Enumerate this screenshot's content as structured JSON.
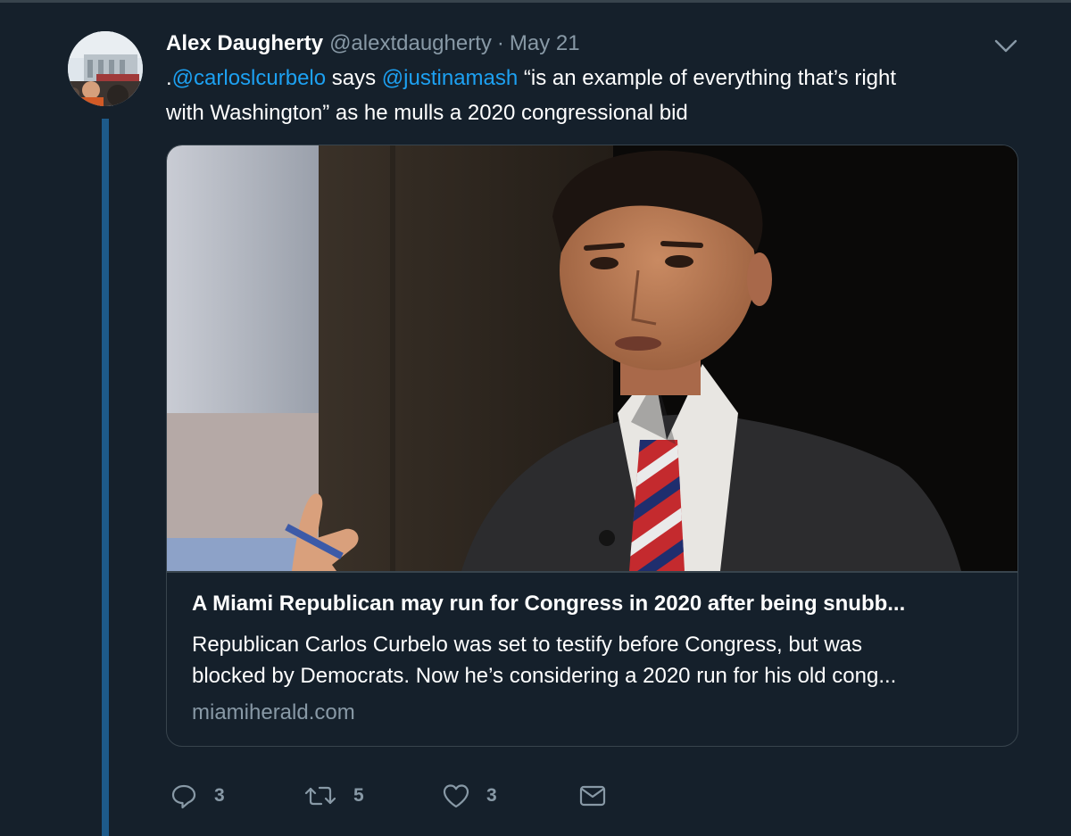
{
  "tweet": {
    "display_name": "Alex Daugherty",
    "handle": "@alextdaugherty",
    "separator": "·",
    "date": "May 21",
    "text": {
      "prefix": ".",
      "mention_1": "@carloslcurbelo",
      "middle": " says ",
      "mention_2": "@justinamash",
      "line1_rest": " “is an example of everything that’s right",
      "line2": "with Washington” as he mulls a 2020 congressional bid"
    }
  },
  "card": {
    "title": "A Miami Republican may run for Congress in 2020 after being snubb...",
    "description_line1": "Republican Carlos Curbelo was set to testify before Congress, but was",
    "description_line2": "blocked by Democrats. Now he’s considering a 2020 run for his old cong...",
    "domain": "miamiherald.com"
  },
  "actions": {
    "reply_count": "3",
    "retweet_count": "5",
    "like_count": "3"
  },
  "icons": {
    "reply": "reply-icon",
    "retweet": "retweet-icon",
    "like": "heart-icon",
    "message": "envelope-icon",
    "menu": "chevron-down-icon"
  },
  "colors": {
    "background": "#15202b",
    "link": "#1da1f2",
    "secondary_text": "#8899a6",
    "border": "#38444d",
    "thread_line": "#1d5a8a"
  }
}
